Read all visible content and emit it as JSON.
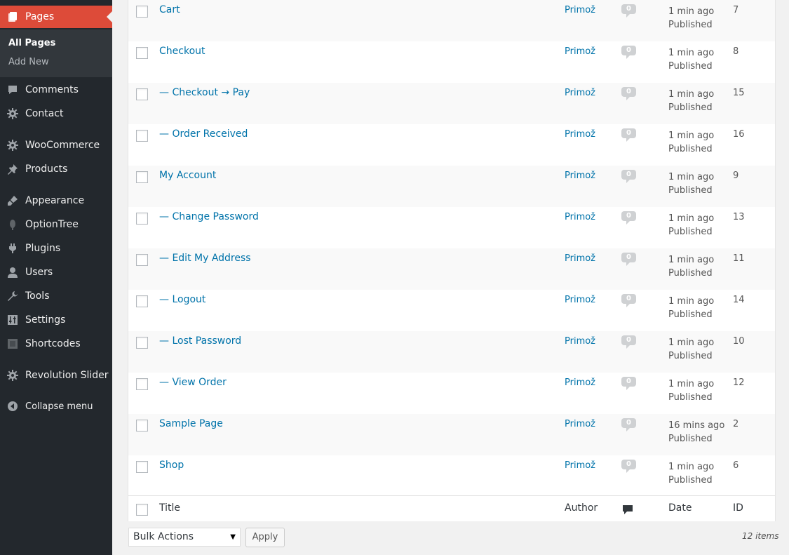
{
  "sidebar": {
    "pages_label": "Pages",
    "submenu": {
      "all_pages": "All Pages",
      "add_new": "Add New"
    },
    "items": {
      "comments": "Comments",
      "contact": "Contact",
      "woocommerce": "WooCommerce",
      "products": "Products",
      "appearance": "Appearance",
      "optiontree": "OptionTree",
      "plugins": "Plugins",
      "users": "Users",
      "tools": "Tools",
      "settings": "Settings",
      "shortcodes": "Shortcodes",
      "revolution_slider": "Revolution Slider"
    },
    "collapse": "Collapse menu",
    "accent_color": "#dd4b39",
    "background_color": "#23282d"
  },
  "rows": [
    {
      "title": "Cart",
      "author": "Primož",
      "comments": "0",
      "date": "1 min ago",
      "status": "Published",
      "id": "7"
    },
    {
      "title": "Checkout",
      "author": "Primož",
      "comments": "0",
      "date": "1 min ago",
      "status": "Published",
      "id": "8"
    },
    {
      "title": "— Checkout → Pay",
      "author": "Primož",
      "comments": "0",
      "date": "1 min ago",
      "status": "Published",
      "id": "15"
    },
    {
      "title": "— Order Received",
      "author": "Primož",
      "comments": "0",
      "date": "1 min ago",
      "status": "Published",
      "id": "16"
    },
    {
      "title": "My Account",
      "author": "Primož",
      "comments": "0",
      "date": "1 min ago",
      "status": "Published",
      "id": "9"
    },
    {
      "title": "— Change Password",
      "author": "Primož",
      "comments": "0",
      "date": "1 min ago",
      "status": "Published",
      "id": "13"
    },
    {
      "title": "— Edit My Address",
      "author": "Primož",
      "comments": "0",
      "date": "1 min ago",
      "status": "Published",
      "id": "11"
    },
    {
      "title": "— Logout",
      "author": "Primož",
      "comments": "0",
      "date": "1 min ago",
      "status": "Published",
      "id": "14"
    },
    {
      "title": "— Lost Password",
      "author": "Primož",
      "comments": "0",
      "date": "1 min ago",
      "status": "Published",
      "id": "10"
    },
    {
      "title": "— View Order",
      "author": "Primož",
      "comments": "0",
      "date": "1 min ago",
      "status": "Published",
      "id": "12"
    },
    {
      "title": "Sample Page",
      "author": "Primož",
      "comments": "0",
      "date": "16 mins ago",
      "status": "Published",
      "id": "2"
    },
    {
      "title": "Shop",
      "author": "Primož",
      "comments": "0",
      "date": "1 min ago",
      "status": "Published",
      "id": "6"
    }
  ],
  "footer": {
    "title": "Title",
    "author": "Author",
    "comments_icon": "comment-icon",
    "date": "Date",
    "id": "ID"
  },
  "bulk_actions": {
    "selected": "Bulk Actions",
    "apply": "Apply",
    "item_count": "12 items"
  },
  "colors": {
    "link": "#0073aa",
    "text": "#555555"
  }
}
